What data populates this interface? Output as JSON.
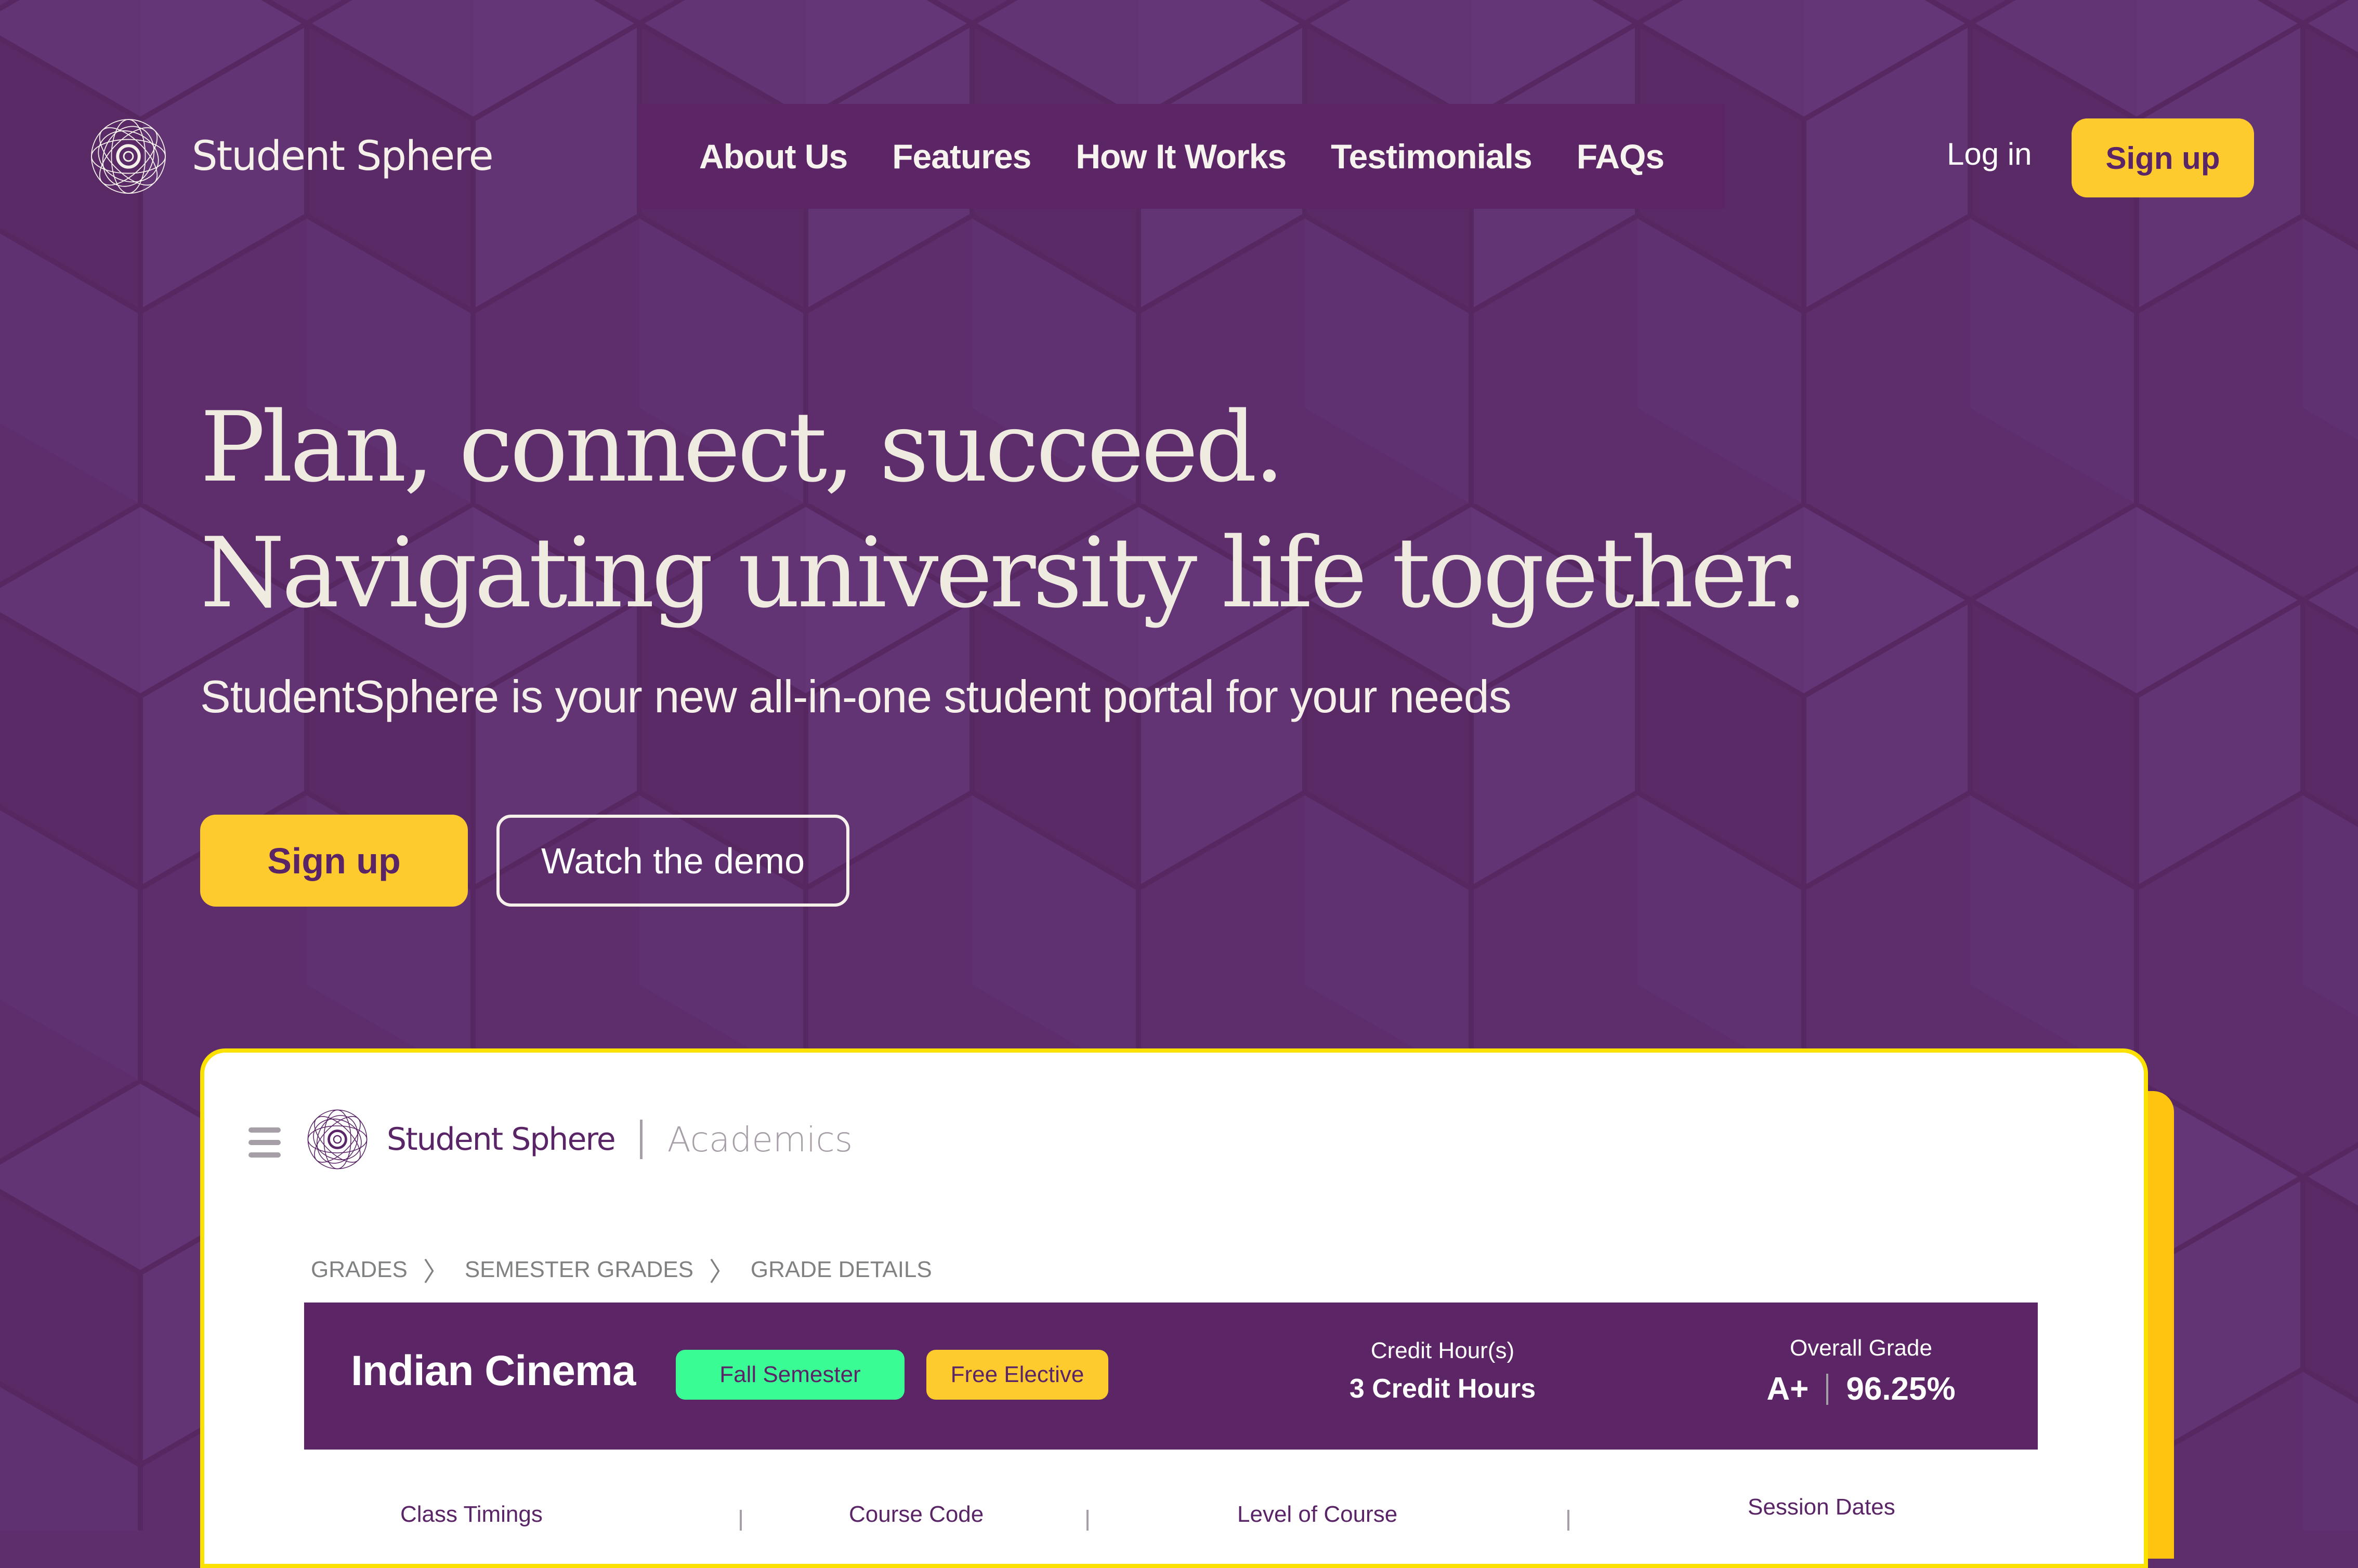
{
  "brand": {
    "name": "Student Sphere",
    "logo_icon": "sphere-logo-icon"
  },
  "colors": {
    "background": "#5e2d6c",
    "primary": "#5c2666",
    "accent_yellow": "#fecb2f",
    "accent_green": "#3afc95",
    "card_border": "#fbe100",
    "text_light": "#f0ebe0"
  },
  "nav": {
    "items": [
      {
        "label": "About Us"
      },
      {
        "label": "Features"
      },
      {
        "label": "How It Works"
      },
      {
        "label": "Testimonials"
      },
      {
        "label": "FAQs"
      }
    ],
    "login_label": "Log in",
    "signup_label": "Sign up"
  },
  "hero": {
    "headline_line1": "Plan, connect, succeed.",
    "headline_line2": "Navigating university life together.",
    "subtitle": "StudentSphere is your new all-in-one student portal for your needs",
    "signup_label": "Sign up",
    "demo_label": "Watch the demo"
  },
  "preview": {
    "brand_name": "Student Sphere",
    "section": "Academics",
    "breadcrumb": [
      "GRADES",
      "SEMESTER GRADES",
      "GRADE DETAILS"
    ],
    "course": {
      "title": "Indian Cinema",
      "tags": [
        "Fall Semester",
        "Free Elective"
      ],
      "credit_label": "Credit Hour(s)",
      "credit_value": "3 Credit Hours",
      "grade_label": "Overall Grade",
      "grade_letter": "A+",
      "grade_percent": "96.25%"
    },
    "info_labels": [
      "Class Timings",
      "Course Code",
      "Level of Course",
      "Session Dates"
    ]
  }
}
